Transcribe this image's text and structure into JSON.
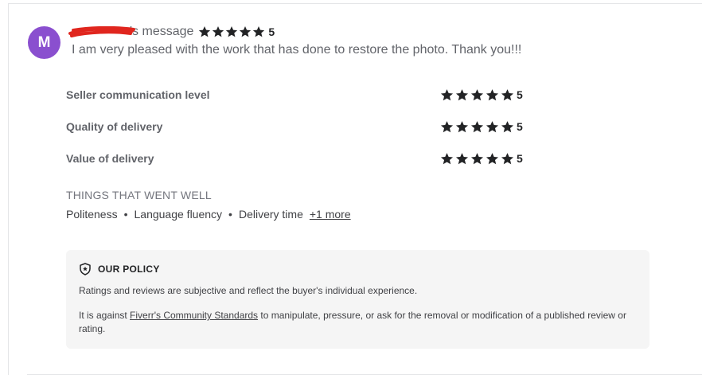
{
  "review": {
    "avatar_letter": "M",
    "username_suffix": "'s message",
    "rating": "5",
    "comment": "I am very pleased with the work that has done to restore the photo. Thank you!!!"
  },
  "sub_ratings": [
    {
      "label": "Seller communication level",
      "value": "5"
    },
    {
      "label": "Quality of delivery",
      "value": "5"
    },
    {
      "label": "Value of delivery",
      "value": "5"
    }
  ],
  "went_well": {
    "title": "THINGS THAT WENT WELL",
    "tags": [
      "Politeness",
      "Language fluency",
      "Delivery time"
    ],
    "more": "+1 more"
  },
  "policy": {
    "title": "OUR POLICY",
    "text1": "Ratings and reviews are subjective and reflect the buyer's individual experience.",
    "text2_prefix": "It is against ",
    "link": "Fiverr's Community Standards",
    "text2_suffix": " to manipulate, pressure, or ask for the removal or modification of a published review or rating."
  },
  "icons": {
    "star": "star-icon",
    "shield": "shield-star-icon",
    "redaction": "red-scribble"
  },
  "colors": {
    "avatar_bg": "#8a4fcf",
    "star": "#222325",
    "redaction": "#e0261e",
    "policy_bg": "#f5f5f5"
  }
}
